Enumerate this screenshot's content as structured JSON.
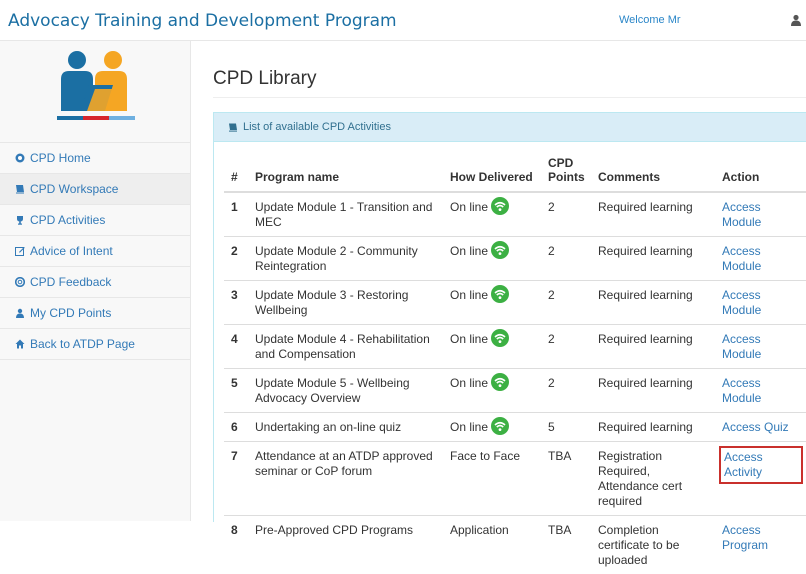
{
  "header": {
    "title": "Advocacy Training and Development Program",
    "welcome": "Welcome Mr"
  },
  "sidebar": {
    "items": [
      {
        "label": "CPD Home",
        "icon": "dashboard-icon"
      },
      {
        "label": "CPD Workspace",
        "icon": "book-icon",
        "active": true
      },
      {
        "label": "CPD Activities",
        "icon": "trophy-icon"
      },
      {
        "label": "Advice of Intent",
        "icon": "edit-icon"
      },
      {
        "label": "CPD Feedback",
        "icon": "lifebuoy-icon"
      },
      {
        "label": "My CPD Points",
        "icon": "user-icon"
      },
      {
        "label": "Back to ATDP Page",
        "icon": "home-icon"
      }
    ]
  },
  "main": {
    "page_title": "CPD Library",
    "panel_title": "List of available CPD Activities",
    "columns": [
      "#",
      "Program name",
      "How Delivered",
      "CPD Points",
      "Comments",
      "Action"
    ],
    "rows": [
      {
        "num": "1",
        "name": "Update Module 1 - Transition and MEC",
        "delivered": "On line",
        "online": true,
        "points": "2",
        "comments": "Required learning",
        "action": "Access Module"
      },
      {
        "num": "2",
        "name": "Update Module 2 - Community Reintegration",
        "delivered": "On line",
        "online": true,
        "points": "2",
        "comments": "Required learning",
        "action": "Access Module"
      },
      {
        "num": "3",
        "name": "Update Module 3 - Restoring Wellbeing",
        "delivered": "On line",
        "online": true,
        "points": "2",
        "comments": "Required learning",
        "action": "Access Module"
      },
      {
        "num": "4",
        "name": "Update Module 4 - Rehabilitation and Compensation",
        "delivered": "On line",
        "online": true,
        "points": "2",
        "comments": "Required learning",
        "action": "Access Module"
      },
      {
        "num": "5",
        "name": "Update Module 5 - Wellbeing Advocacy Overview",
        "delivered": "On line",
        "online": true,
        "points": "2",
        "comments": "Required learning",
        "action": "Access Module"
      },
      {
        "num": "6",
        "name": "Undertaking an on-line quiz",
        "delivered": "On line",
        "online": true,
        "points": "5",
        "comments": "Required learning",
        "action": "Access Quiz"
      },
      {
        "num": "7",
        "name": "Attendance at an ATDP approved seminar or CoP forum",
        "delivered": "Face to Face",
        "online": false,
        "points": "TBA",
        "comments": "Registration Required, Attendance cert required",
        "action": "Access Activity",
        "highlighted": true
      },
      {
        "num": "8",
        "name": "Pre-Approved CPD Programs",
        "delivered": "Application",
        "online": false,
        "points": "TBA",
        "comments": "Completion certificate to be uploaded",
        "action": "Access Program"
      }
    ]
  },
  "colors": {
    "brand": "#1b6fa3",
    "link": "#337ab7",
    "panel_head": "#d9edf7",
    "highlight_border": "#c9302c",
    "online_green": "#3cb043"
  }
}
